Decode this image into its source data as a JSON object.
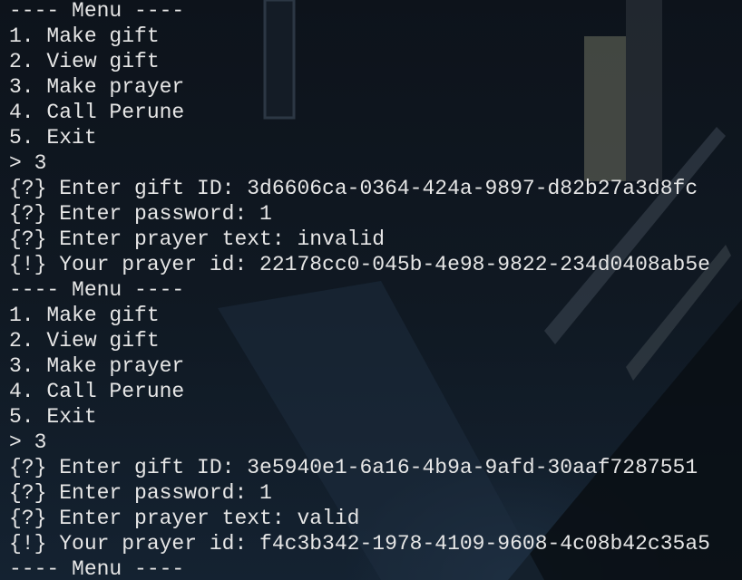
{
  "terminal": {
    "lines": [
      "---- Menu ----",
      "1. Make gift",
      "2. View gift",
      "3. Make prayer",
      "4. Call Perune",
      "5. Exit",
      "> 3",
      "{?} Enter gift ID: 3d6606ca-0364-424a-9897-d82b27a3d8fc",
      "{?} Enter password: 1",
      "{?} Enter prayer text: invalid",
      "{!} Your prayer id: 22178cc0-045b-4e98-9822-234d0408ab5e",
      "---- Menu ----",
      "1. Make gift",
      "2. View gift",
      "3. Make prayer",
      "4. Call Perune",
      "5. Exit",
      "> 3",
      "{?} Enter gift ID: 3e5940e1-6a16-4b9a-9afd-30aaf7287551",
      "{?} Enter password: 1",
      "{?} Enter prayer text: valid",
      "{!} Your prayer id: f4c3b342-1978-4109-9608-4c08b42c35a5",
      "---- Menu ----"
    ]
  },
  "colors": {
    "text": "#e6e6e6",
    "background": "#0d131b"
  }
}
